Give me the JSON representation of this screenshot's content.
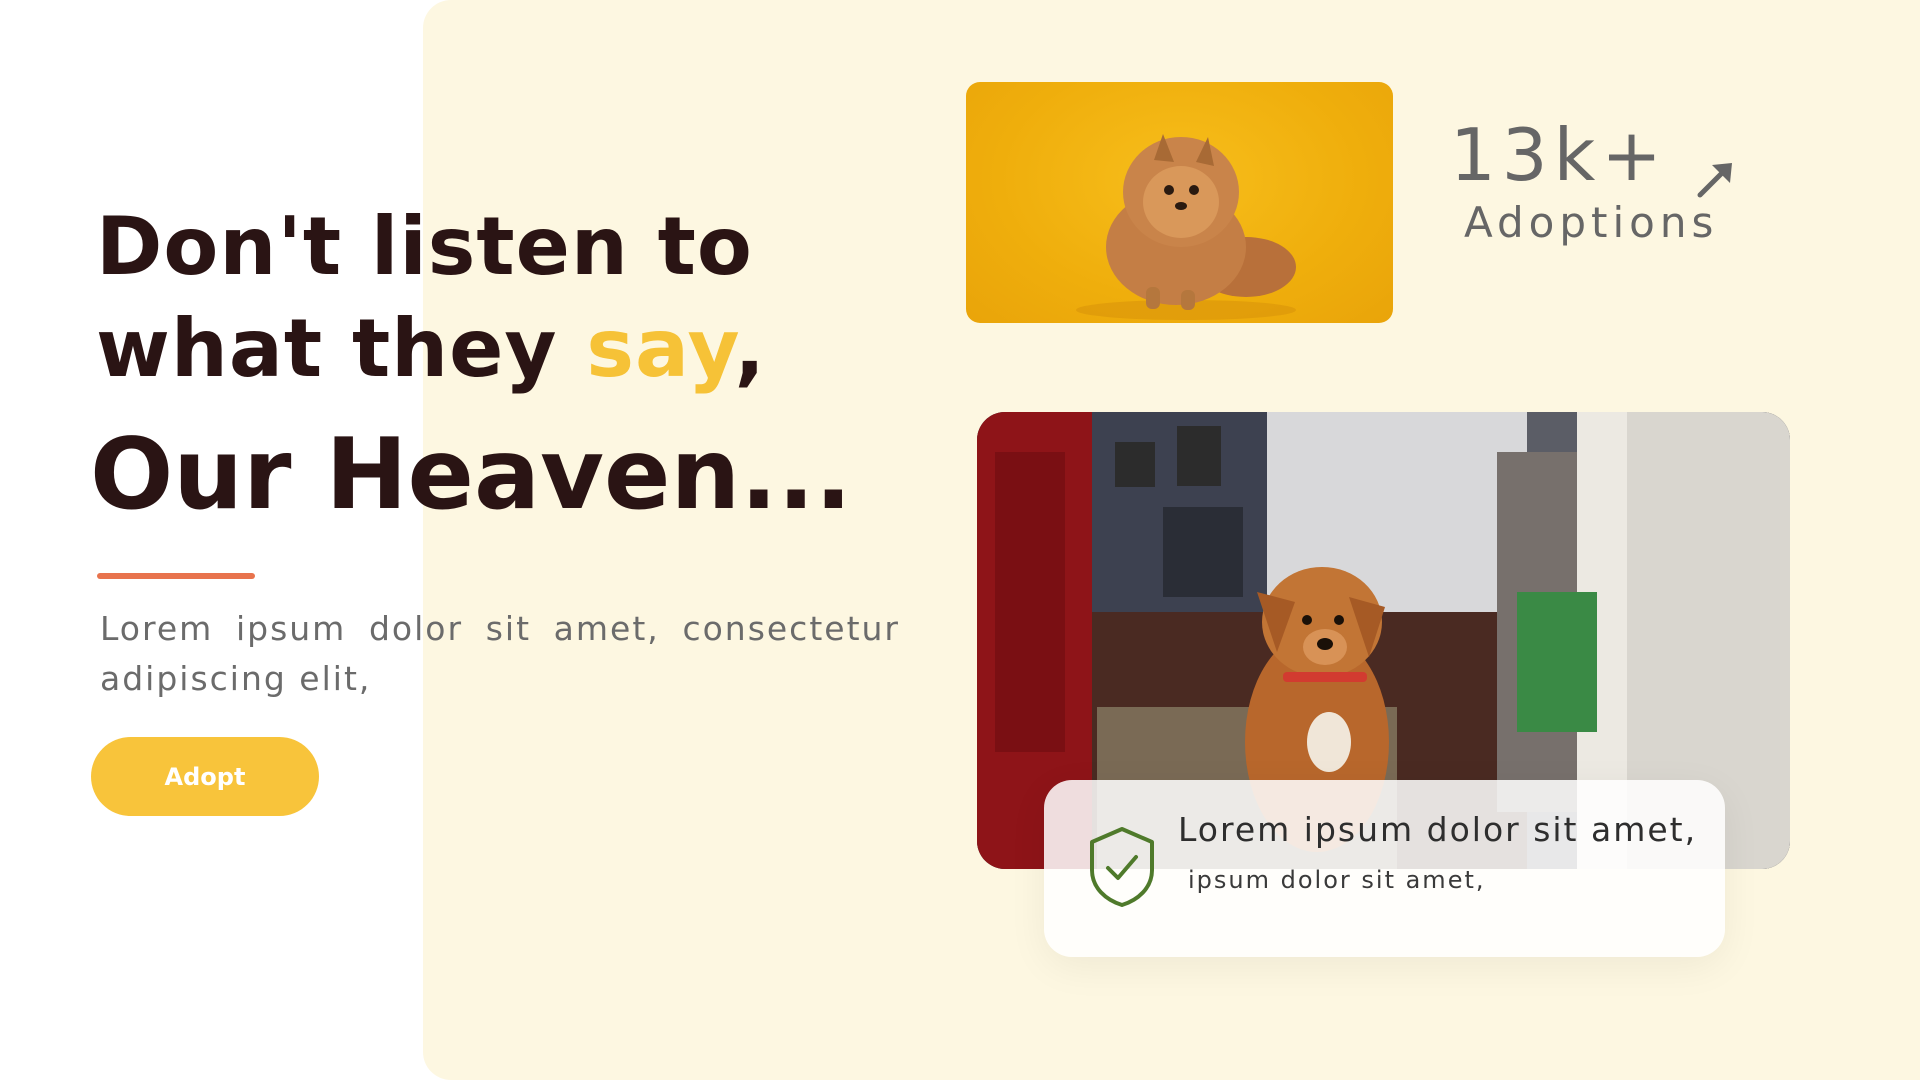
{
  "hero": {
    "headline_line1": "Don't listen to",
    "headline_line2_a": "what they ",
    "headline_line2_accent": "say",
    "headline_line2_b": ",",
    "headline_line3": "Our Heaven...",
    "lead_text": "Lorem ipsum dolor sit amet, consectetur adipiscing elit,",
    "adopt_label": "Adopt"
  },
  "stats": {
    "adoptions_value": "13k+",
    "adoptions_label": "Adoptions",
    "trend_icon": "arrow-up-right-icon"
  },
  "info_card": {
    "title": "Lorem ipsum dolor sit amet,",
    "subtitle": "ipsum dolor sit amet,",
    "icon": "shield-check-icon"
  },
  "colors": {
    "accent_yellow": "#f6c237",
    "button_yellow": "#f8c43b",
    "underline_orange": "#e8734d",
    "panel_cream": "#fdf7e1",
    "heading_dark": "#2a1414",
    "shield_green": "#4f7a2b"
  }
}
